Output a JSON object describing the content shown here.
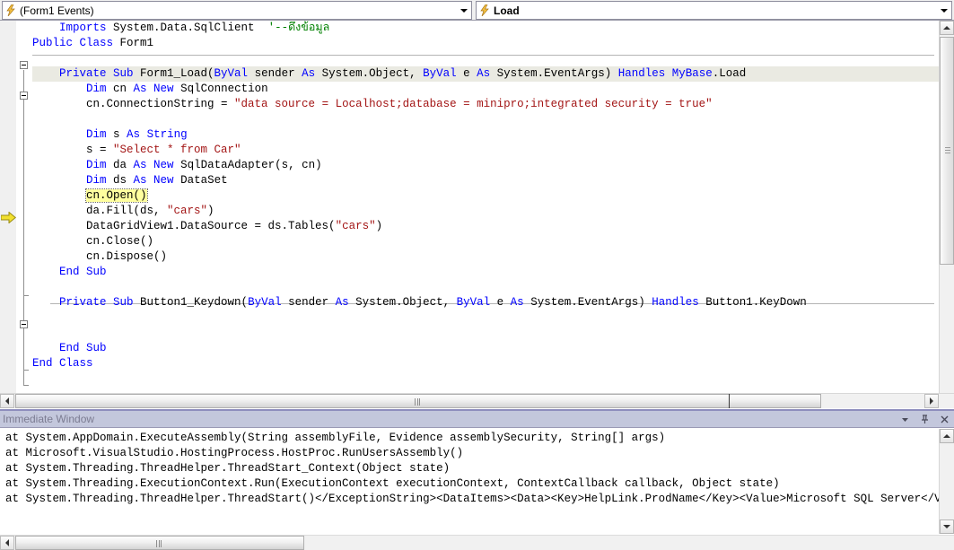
{
  "toolbar": {
    "object_combo": {
      "icon": "lightning-bolt-icon",
      "value": "(Form1 Events)"
    },
    "member_combo": {
      "icon": "lightning-bolt-icon",
      "value": "Load"
    }
  },
  "editor": {
    "lines": [
      {
        "id": "l1",
        "indent": 4,
        "segments": [
          {
            "t": "Imports",
            "c": "kw"
          },
          {
            "t": " System.Data.SqlClient  ",
            "c": ""
          },
          {
            "t": "'--ดึงข้อมูล",
            "c": "cmt"
          }
        ]
      },
      {
        "id": "l2",
        "indent": 0,
        "segments": [
          {
            "t": "Public Class",
            "c": "kw"
          },
          {
            "t": " Form1",
            "c": ""
          }
        ]
      },
      {
        "id": "l3",
        "indent": 0,
        "segments": []
      },
      {
        "id": "l4",
        "indent": 4,
        "segments": [
          {
            "t": "Private Sub",
            "c": "kw"
          },
          {
            "t": " Form1_Load(",
            "c": ""
          },
          {
            "t": "ByVal",
            "c": "kw"
          },
          {
            "t": " sender ",
            "c": ""
          },
          {
            "t": "As",
            "c": "kw"
          },
          {
            "t": " System.Object, ",
            "c": ""
          },
          {
            "t": "ByVal",
            "c": "kw"
          },
          {
            "t": " e ",
            "c": ""
          },
          {
            "t": "As",
            "c": "kw"
          },
          {
            "t": " System.EventArgs) ",
            "c": ""
          },
          {
            "t": "Handles",
            "c": "kw"
          },
          {
            "t": " ",
            "c": ""
          },
          {
            "t": "MyBase",
            "c": "kw"
          },
          {
            "t": ".Load",
            "c": ""
          }
        ]
      },
      {
        "id": "l5",
        "indent": 8,
        "segments": [
          {
            "t": "Dim",
            "c": "kw"
          },
          {
            "t": " cn ",
            "c": ""
          },
          {
            "t": "As New",
            "c": "kw"
          },
          {
            "t": " SqlConnection",
            "c": ""
          }
        ]
      },
      {
        "id": "l6",
        "indent": 8,
        "segments": [
          {
            "t": "cn.ConnectionString = ",
            "c": ""
          },
          {
            "t": "\"data source = Localhost;database = minipro;integrated security = true\"",
            "c": "str"
          }
        ]
      },
      {
        "id": "l7",
        "indent": 0,
        "segments": []
      },
      {
        "id": "l8",
        "indent": 8,
        "segments": [
          {
            "t": "Dim",
            "c": "kw"
          },
          {
            "t": " s ",
            "c": ""
          },
          {
            "t": "As",
            "c": "kw"
          },
          {
            "t": " ",
            "c": ""
          },
          {
            "t": "String",
            "c": "kw"
          }
        ]
      },
      {
        "id": "l9",
        "indent": 8,
        "segments": [
          {
            "t": "s = ",
            "c": ""
          },
          {
            "t": "\"Select * from Car\"",
            "c": "str"
          }
        ]
      },
      {
        "id": "l10",
        "indent": 8,
        "segments": [
          {
            "t": "Dim",
            "c": "kw"
          },
          {
            "t": " da ",
            "c": ""
          },
          {
            "t": "As New",
            "c": "kw"
          },
          {
            "t": " SqlDataAdapter(s, cn)",
            "c": ""
          }
        ]
      },
      {
        "id": "l11",
        "indent": 8,
        "segments": [
          {
            "t": "Dim",
            "c": "kw"
          },
          {
            "t": " ds ",
            "c": ""
          },
          {
            "t": "As New",
            "c": "kw"
          },
          {
            "t": " DataSet",
            "c": ""
          }
        ]
      },
      {
        "id": "l12",
        "indent": 8,
        "segments": [
          {
            "t": "cn.Open()",
            "c": "exec"
          }
        ]
      },
      {
        "id": "l13",
        "indent": 8,
        "segments": [
          {
            "t": "da.Fill(ds, ",
            "c": ""
          },
          {
            "t": "\"cars\"",
            "c": "str"
          },
          {
            "t": ")",
            "c": ""
          }
        ]
      },
      {
        "id": "l14",
        "indent": 8,
        "segments": [
          {
            "t": "DataGridView1.DataSource = ds.Tables(",
            "c": ""
          },
          {
            "t": "\"cars\"",
            "c": "str"
          },
          {
            "t": ")",
            "c": ""
          }
        ]
      },
      {
        "id": "l15",
        "indent": 8,
        "segments": [
          {
            "t": "cn.Close()",
            "c": ""
          }
        ]
      },
      {
        "id": "l16",
        "indent": 8,
        "segments": [
          {
            "t": "cn.Dispose()",
            "c": ""
          }
        ]
      },
      {
        "id": "l17",
        "indent": 4,
        "segments": [
          {
            "t": "End Sub",
            "c": "kw"
          }
        ]
      },
      {
        "id": "l18",
        "indent": 0,
        "segments": []
      },
      {
        "id": "l19",
        "indent": 4,
        "segments": [
          {
            "t": "Private Sub",
            "c": "kw"
          },
          {
            "t": " Button1_Keydown(",
            "c": ""
          },
          {
            "t": "ByVal",
            "c": "kw"
          },
          {
            "t": " sender ",
            "c": ""
          },
          {
            "t": "As",
            "c": "kw"
          },
          {
            "t": " System.Object, ",
            "c": ""
          },
          {
            "t": "ByVal",
            "c": "kw"
          },
          {
            "t": " e ",
            "c": ""
          },
          {
            "t": "As",
            "c": "kw"
          },
          {
            "t": " System.EventArgs) ",
            "c": ""
          },
          {
            "t": "Handles",
            "c": "kw"
          },
          {
            "t": " Button1.KeyDown",
            "c": ""
          }
        ]
      },
      {
        "id": "l20",
        "indent": 0,
        "segments": []
      },
      {
        "id": "l21",
        "indent": 0,
        "segments": []
      },
      {
        "id": "l22",
        "indent": 4,
        "segments": [
          {
            "t": "End Sub",
            "c": "kw"
          }
        ]
      },
      {
        "id": "l23",
        "indent": 0,
        "segments": [
          {
            "t": "End Class",
            "c": "kw"
          }
        ]
      }
    ],
    "current_execution_line": "cn.Open()",
    "colors": {
      "keyword": "#0000ff",
      "string": "#a31515",
      "comment": "#008000",
      "text": "#000000",
      "exec_highlight": "#ffff9e",
      "signature_highlight": "#eaeae2"
    }
  },
  "immediate_window": {
    "title": "Immediate Window",
    "controls": [
      {
        "name": "window-menu-dropdown",
        "glyph": "chevron-down-icon"
      },
      {
        "name": "auto-hide-pin",
        "glyph": "pin-icon"
      },
      {
        "name": "close",
        "glyph": "close-icon"
      }
    ],
    "lines": [
      "at System.AppDomain.ExecuteAssembly(String assemblyFile, Evidence assemblySecurity, String[] args)",
      "at Microsoft.VisualStudio.HostingProcess.HostProc.RunUsersAssembly()",
      "at System.Threading.ThreadHelper.ThreadStart_Context(Object state)",
      "at System.Threading.ExecutionContext.Run(ExecutionContext executionContext, ContextCallback callback, Object state)",
      "at System.Threading.ThreadHelper.ThreadStart()</ExceptionString><DataItems><Data><Key>HelpLink.ProdName</Key><Value>Microsoft SQL Server</Value></D"
    ]
  }
}
